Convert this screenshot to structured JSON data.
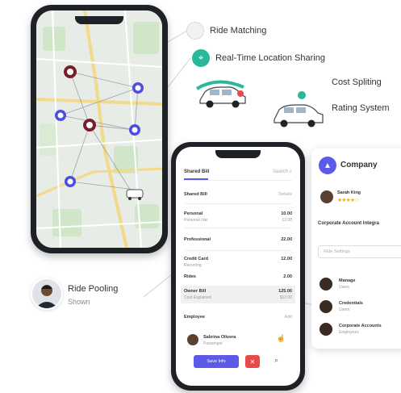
{
  "features": {
    "ride_matching": "Ride Matching",
    "location_sharing": "Real-Time Location Sharing",
    "cost_splitting": "Cost Spliting",
    "rating_system": "Rating System",
    "ride_pooling": "Ride Pooling",
    "ride_pooling_sub": "Shown"
  },
  "bill_phone": {
    "tab": "Shared Bill",
    "search": "Search",
    "section_title": "Shared Bill",
    "section_right": "Details",
    "rows": [
      {
        "label": "Personal",
        "sub": "Personal ride",
        "value": "10.00",
        "value2": "12.00"
      },
      {
        "label": "Professional",
        "sub": "",
        "value": "22.00",
        "value2": ""
      },
      {
        "label": "Credit Card",
        "sub": "Recurring",
        "value": "12.00",
        "value2": ""
      },
      {
        "label": "Rides",
        "sub": "",
        "value": "2.00",
        "value2": ""
      },
      {
        "label": "Owner Bill",
        "sub": "Cost Explained",
        "value": "125.00",
        "value2": "$12.00"
      }
    ],
    "employee_heading": "Employee",
    "employee_heading_right": "Add",
    "employee_name": "Sabrina Olivera",
    "employee_role": "Passenger",
    "primary_button": "Save Info",
    "danger_button": "✕"
  },
  "company": {
    "title": "Company",
    "driver_name": "Sarah King",
    "stars": "★★★★☆",
    "section": "Corporate Account Integra",
    "select_placeholder": "Ride Settings",
    "members": [
      {
        "name": "Manage",
        "sub": "Users"
      },
      {
        "name": "Credentials",
        "sub": "Users"
      },
      {
        "name": "Corporate Accounts",
        "sub": "Employees"
      }
    ]
  },
  "colors": {
    "accent_purple": "#5b5be8",
    "accent_teal": "#29b89a",
    "danger_red": "#e84a4a",
    "star_yellow": "#f5b400"
  }
}
